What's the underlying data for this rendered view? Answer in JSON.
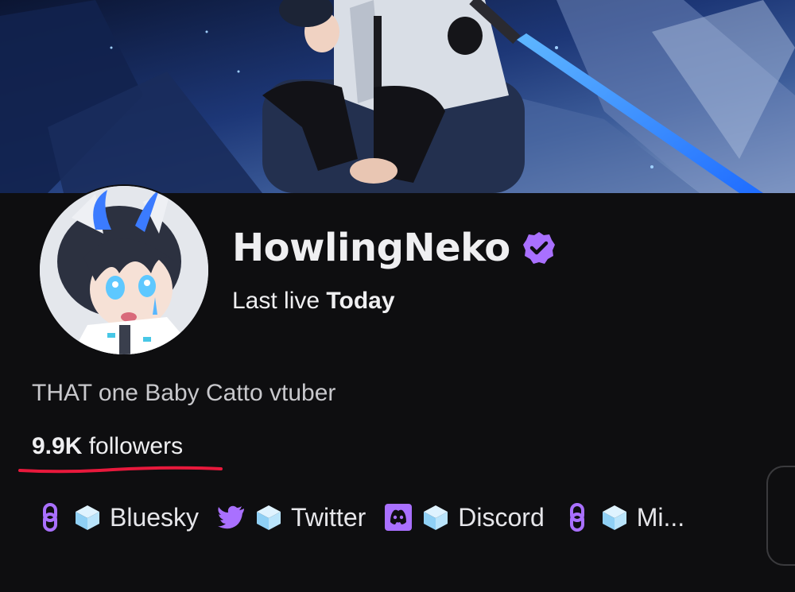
{
  "channel": {
    "name": "HowlingNeko",
    "verified": true,
    "last_live_prefix": "Last live",
    "last_live_value": "Today"
  },
  "about": {
    "bio": "THAT one Baby Catto vtuber",
    "followers_count": "9.9K",
    "followers_label": "followers"
  },
  "socials": [
    {
      "platform_icon": "link-icon",
      "decor_icon": "ice-cube-icon",
      "label": "Bluesky"
    },
    {
      "platform_icon": "twitter-bird-icon",
      "decor_icon": "ice-cube-icon",
      "label": "Twitter"
    },
    {
      "platform_icon": "discord-icon",
      "decor_icon": "ice-cube-icon",
      "label": "Discord"
    },
    {
      "platform_icon": "link-icon",
      "decor_icon": "ice-cube-icon",
      "label": "Mi..."
    }
  ],
  "colors": {
    "background": "#0e0e10",
    "accent_purple": "#a970ff",
    "annotation_red": "#e8193c",
    "text_primary": "#efeff1"
  }
}
